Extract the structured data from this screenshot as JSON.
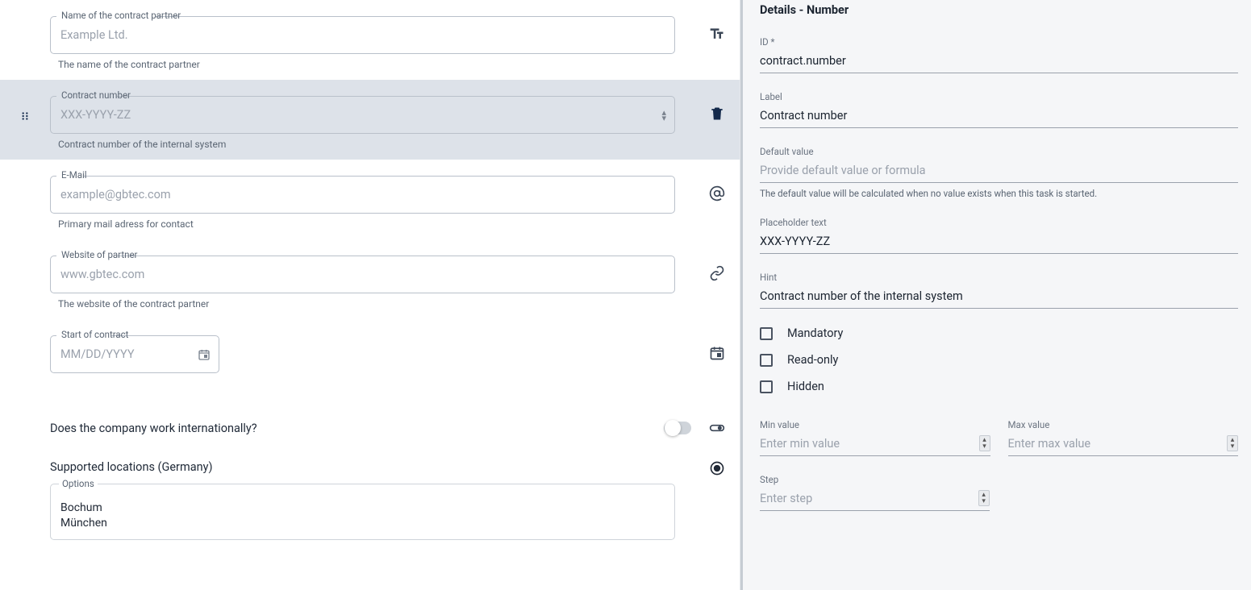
{
  "form": {
    "fields": [
      {
        "label": "Name of the contract partner",
        "placeholder": "Example Ltd.",
        "helper": "The name of the contract partner",
        "icon": "text-size-icon"
      },
      {
        "label": "Contract number",
        "placeholder": "XXX-YYYY-ZZ",
        "helper": "Contract number of the internal system",
        "icon": "delete-icon",
        "selected": true,
        "kind": "number"
      },
      {
        "label": "E-Mail",
        "placeholder": "example@gbtec.com",
        "helper": "Primary mail adress for contact",
        "icon": "email-icon"
      },
      {
        "label": "Website of partner",
        "placeholder": "www.gbtec.com",
        "helper": "The website of the contract partner",
        "icon": "link-icon"
      },
      {
        "label": "Start of contract",
        "placeholder": "MM/DD/YYYY",
        "helper": "",
        "icon": "calendar-icon",
        "kind": "date"
      }
    ],
    "boolean": {
      "label": "Does the company work internationally?",
      "icon": "toggle-icon"
    },
    "radio": {
      "heading": "Supported locations (Germany)",
      "options_label": "Options",
      "options": [
        "Bochum",
        "München"
      ],
      "icon": "radio-icon"
    }
  },
  "details": {
    "title": "Details - Number",
    "id_label": "ID *",
    "id_value": "contract.number",
    "label_label": "Label",
    "label_value": "Contract number",
    "default_label": "Default value",
    "default_placeholder": "Provide default value or formula",
    "default_hint": "The default value will be calculated when no value exists when this task is started.",
    "placeholder_label": "Placeholder text",
    "placeholder_value": "XXX-YYYY-ZZ",
    "hint_label": "Hint",
    "hint_value": "Contract number of the internal system",
    "mandatory_label": "Mandatory",
    "readonly_label": "Read-only",
    "hidden_label": "Hidden",
    "min_label": "Min value",
    "min_placeholder": "Enter min value",
    "max_label": "Max value",
    "max_placeholder": "Enter max value",
    "step_label": "Step",
    "step_placeholder": "Enter step"
  }
}
